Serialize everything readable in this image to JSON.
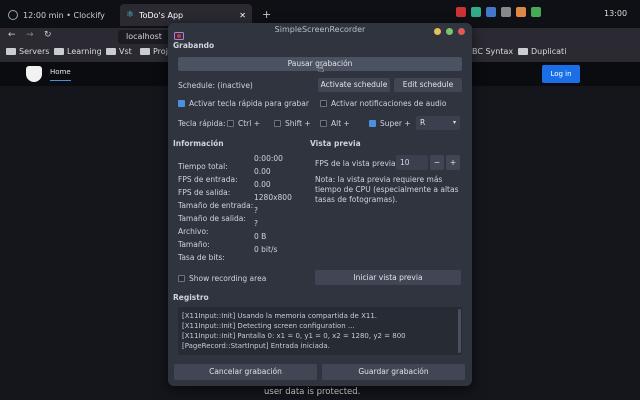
{
  "browser": {
    "tabs": [
      {
        "label": "12:00 min • Clockify"
      },
      {
        "label": "ToDo's App"
      }
    ],
    "new_tab_glyph": "+",
    "url": "localhost",
    "clock": "13:00",
    "bookmarks": [
      "Servers",
      "Learning",
      "Vst",
      "Proj"
    ],
    "bookmarks_right": [
      "BC Syntax",
      "Duplicati"
    ]
  },
  "website": {
    "nav_home": "Home",
    "login_button": "Log in",
    "login_color": "#1a6fe8",
    "footer_text": "user data is protected."
  },
  "dialog": {
    "title": "SimpleScreenRecorder",
    "recording": {
      "heading": "Grabando",
      "pause_button": "Pausar grabación",
      "schedule_label": "Schedule: (inactive)",
      "activate_schedule": "Activate schedule",
      "edit_schedule": "Edit schedule",
      "hotkey_checkbox": "Activar tecla rápida para grabar",
      "notifications_checkbox": "Activar notificaciones de audio",
      "hotkey_label": "Tecla rápida:",
      "mod_ctrl": "Ctrl +",
      "mod_shift": "Shift +",
      "mod_alt": "Alt +",
      "mod_super": "Super +",
      "key_value": "R"
    },
    "info": {
      "heading": "Información",
      "rows": [
        {
          "label": "Tiempo total:",
          "value": "0:00:00"
        },
        {
          "label": "FPS de entrada:",
          "value": "0.00"
        },
        {
          "label": "FPS de salida:",
          "value": "0.00"
        },
        {
          "label": "Tamaño de entrada:",
          "value": "1280x800"
        },
        {
          "label": "Tamaño de salida:",
          "value": "?"
        },
        {
          "label": "Archivo:",
          "value": "?"
        },
        {
          "label": "Tamaño:",
          "value": "0 B"
        },
        {
          "label": "Tasa de bits:",
          "value": "0 bit/s"
        }
      ],
      "show_area": "Show recording area"
    },
    "preview": {
      "heading": "Vista previa",
      "fps_label": "FPS de la vista previa:",
      "fps_value": "10",
      "note": [
        "Nota: la vista previa requiere más",
        "tiempo de CPU (especialmente a altas",
        "tasas de fotogramas)."
      ],
      "start_button": "Iniciar vista previa"
    },
    "log": {
      "heading": "Registro",
      "lines": [
        "[X11Input::Init] Usando la memoria compartida de X11.",
        "[X11Input::Init] Detecting screen configuration ...",
        "[X11Input::Init] Pantalla 0: x1 = 0, y1 = 0, x2 = 1280, y2 = 800",
        "[PageRecord::StartInput] Entrada iniciada."
      ]
    },
    "cancel_button": "Cancelar grabación",
    "save_button": "Guardar grabación"
  }
}
